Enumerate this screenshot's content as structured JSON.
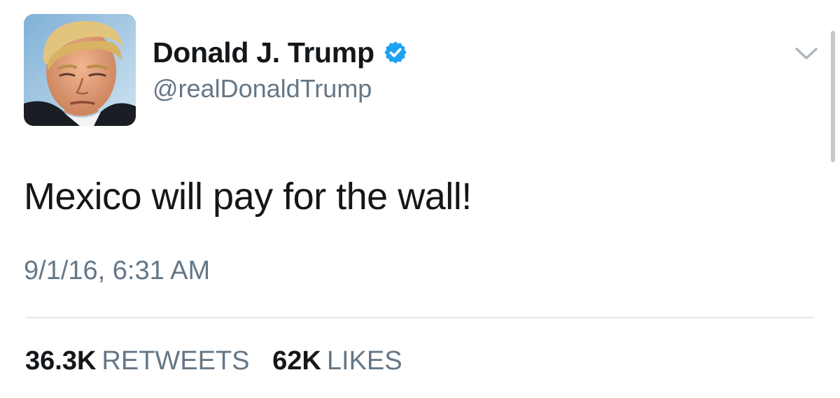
{
  "user": {
    "display_name": "Donald J. Trump",
    "handle": "@realDonaldTrump",
    "verified": true,
    "verified_icon": "verified-badge-icon",
    "avatar_icon": "profile-photo"
  },
  "tweet": {
    "text": "Mexico will pay for the wall!",
    "timestamp": "9/1/16, 6:31 AM"
  },
  "stats": {
    "retweets_count": "36.3K",
    "retweets_label": "RETWEETS",
    "likes_count": "62K",
    "likes_label": "LIKES"
  },
  "menu": {
    "icon": "chevron-down-icon"
  },
  "colors": {
    "text_primary": "#14171a",
    "text_secondary": "#657786",
    "verified_blue": "#1da1f2",
    "divider": "#e1e8ed",
    "chevron": "#aab8c2"
  }
}
